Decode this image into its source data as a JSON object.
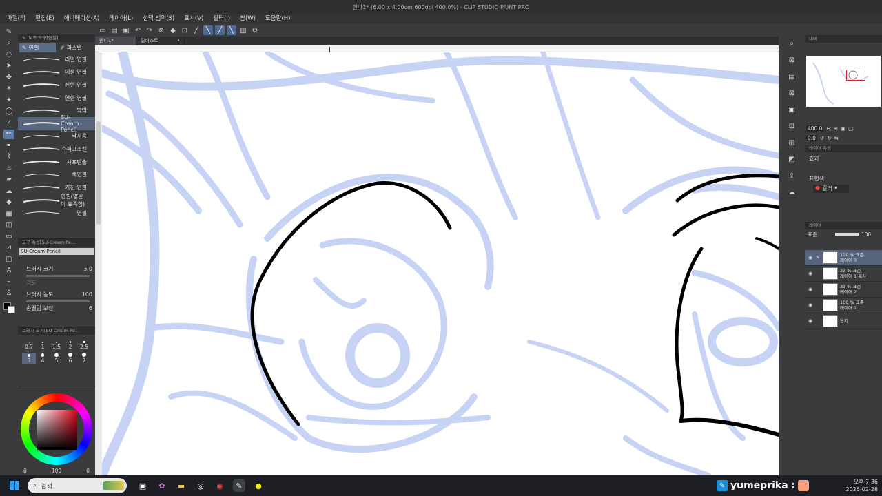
{
  "window": {
    "title": "안나1* (6.00 x 4.00cm 600dpi 400.0%) - CLIP STUDIO PAINT PRO"
  },
  "menu": [
    "파일(F)",
    "편집(E)",
    "애니메이션(A)",
    "레이어(L)",
    "선택 범위(S)",
    "표시(V)",
    "필터(I)",
    "창(W)",
    "도움말(H)"
  ],
  "tabs": [
    {
      "label": "안나1*"
    },
    {
      "label": "일러스트2*"
    }
  ],
  "subtool": {
    "header": "보조 도구[연필]",
    "tab_pencil": "연필",
    "tab_pastel": "파스텔",
    "brushes": [
      "리얼 연필",
      "데생 연필",
      "진한 연필",
      "연한 연필",
      "막막",
      "SU-Cream Pencil",
      "낙서용",
      "슈퍼고조펜",
      "샤프펜슬",
      "색연필",
      "거친 연필",
      "연필(양끝이 뾰족함)",
      "연필"
    ],
    "selected_brush": "SU-Cream Pencil"
  },
  "tool_property": {
    "header": "도구 속성[SU-Cream Pe...",
    "name": "SU-Cream Pencil",
    "brush_size_label": "브러시 크기",
    "brush_size_value": "3.0",
    "hardness_label": "경도",
    "density_label": "브러시 농도",
    "density_value": "100",
    "stabilization_label": "손떨림 보정",
    "stabilization_value": "6"
  },
  "brush_size_panel": {
    "header": "브러시 크기[SU-Cream Pe...",
    "sizes": [
      "0.7",
      "1",
      "1.5",
      "2",
      "2.5",
      "3",
      "4",
      "5",
      "6",
      "7"
    ],
    "selected": "3"
  },
  "color_panel": {
    "accent": "#e0001b",
    "opacity_label": "0",
    "value_a": "100",
    "value_b": "0"
  },
  "navigator": {
    "header": "내비",
    "zoom": "400.0",
    "rotation": "0.0"
  },
  "layer_property": {
    "header": "레이어 속성",
    "effect_label": "효과",
    "expression_label": "표현색",
    "expression_value": "컬러"
  },
  "layers": {
    "header": "레이어",
    "blend_mode": "표준",
    "opacity": "100",
    "items": [
      {
        "meta": "100 % 표준",
        "name": "레이어 3"
      },
      {
        "meta": "23 % 표준",
        "name": "레이어 1 복사"
      },
      {
        "meta": "33 % 표준",
        "name": "레이어 2"
      },
      {
        "meta": "100 % 표준",
        "name": "레이어 1"
      },
      {
        "meta": "",
        "name": "용지"
      }
    ]
  },
  "taskbar": {
    "search_placeholder": "검색",
    "streamer": "yumeprika :",
    "time": "오후 7:36",
    "date": "2026-02-28"
  },
  "colors": {
    "sketch": "#c3d1f3",
    "lineart": "#000000",
    "selection": "#56657c",
    "taskbar": "#1e1f24"
  }
}
